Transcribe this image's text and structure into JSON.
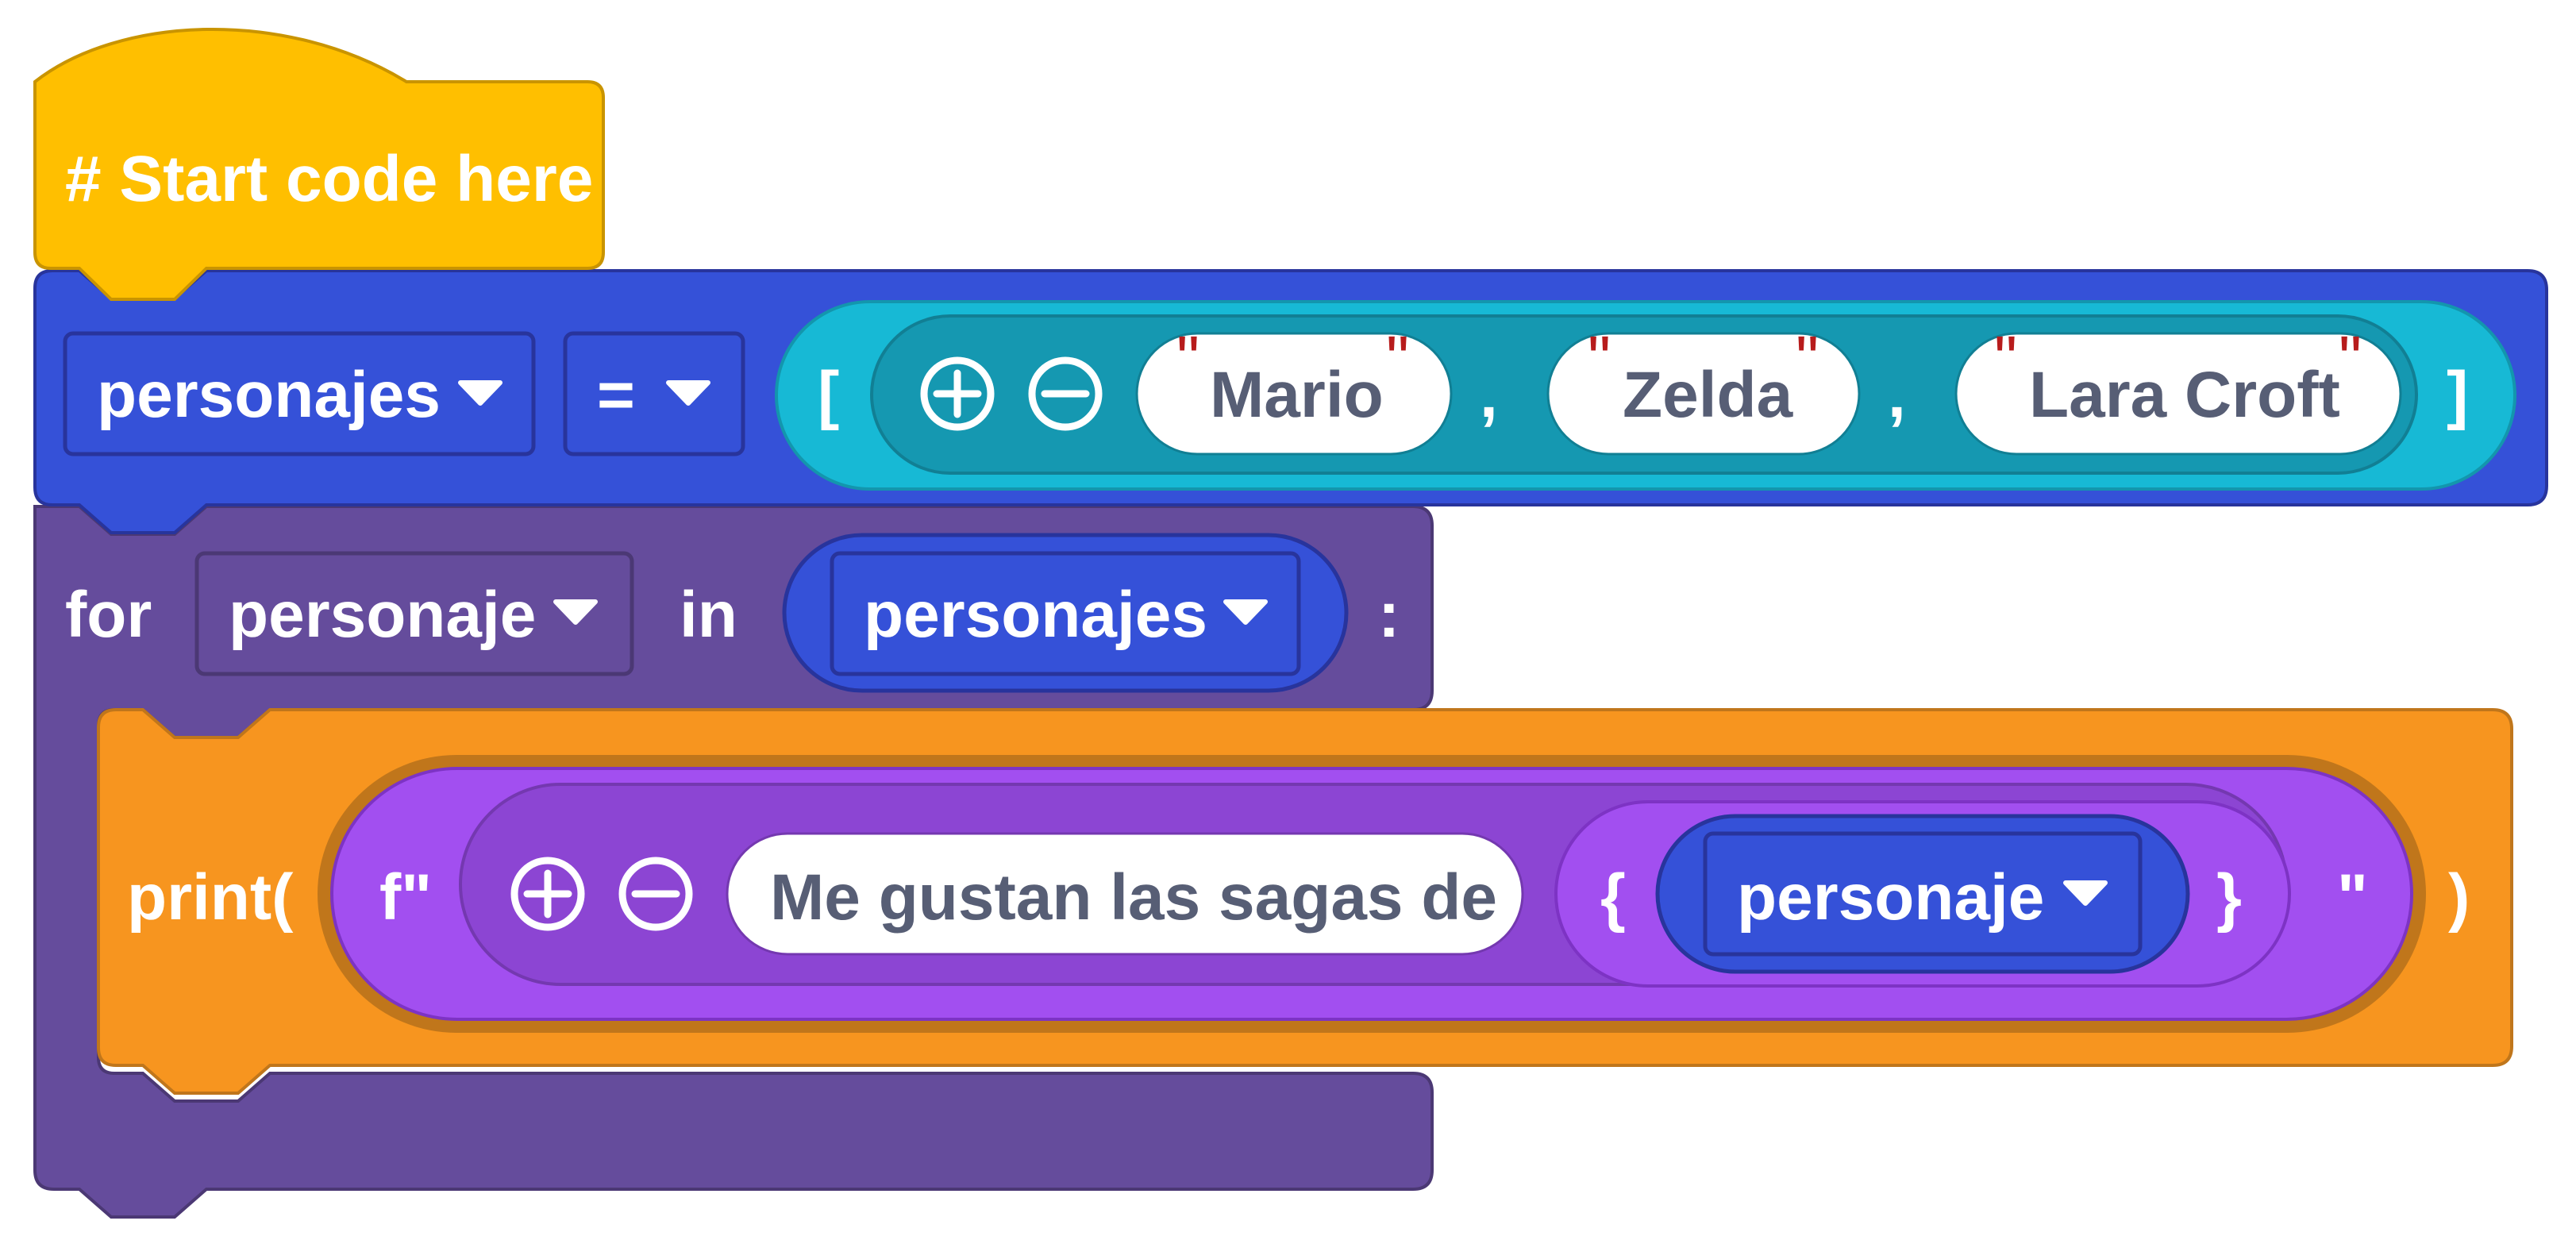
{
  "hat_block": {
    "text": "# Start code here"
  },
  "assign_block": {
    "variable": "personajes",
    "operator": "=",
    "list": {
      "open": "[",
      "close": "]",
      "separator": ",",
      "quote": "\"",
      "items": [
        "Mario",
        "Zelda",
        "Lara Croft"
      ]
    }
  },
  "for_block": {
    "keyword": "for",
    "loop_var": "personaje",
    "in_keyword": "in",
    "iterable": "personajes",
    "colon": ":"
  },
  "print_block": {
    "open": "print(",
    "fstring_open": "f\"",
    "text": "Me gustan las sagas de",
    "brace_open": "{",
    "var": "personaje",
    "brace_close": "}",
    "fstring_close": "\"",
    "close": ")"
  },
  "icons": [
    "plus-circle-icon",
    "minus-circle-icon",
    "dropdown-caret-icon"
  ],
  "colors": {
    "hat": "#ffbf00",
    "assign": "#3551d8",
    "list_outer": "#17b9d5",
    "list_inner": "#1598b1",
    "for": "#654c9c",
    "print": "#f7951f",
    "fstring_outer": "#a24ff0",
    "fstring_inner": "#8c45d3",
    "variable_reporter": "#3551d8",
    "string_text": "#575e75",
    "quote": "#b71c1c"
  }
}
